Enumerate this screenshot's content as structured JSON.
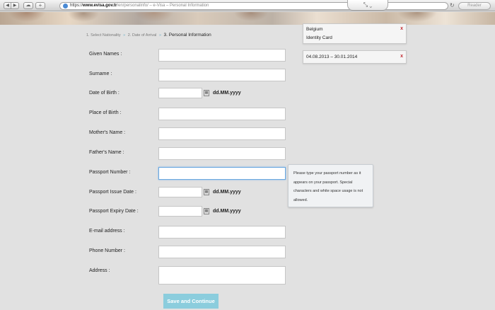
{
  "browser": {
    "url_protocol": "https://",
    "url_host": "www.evisa.gov.tr",
    "url_path": "/en/personalinfo/",
    "page_title": " – e-Visa – Personal Information",
    "reader_label": "Reader",
    "tab_chevron": "⤡  ⌄"
  },
  "steps": {
    "step1": "1. Select Nationality",
    "step2": "2. Date of Arrival",
    "step3": "3. Personal Information",
    "separator": "»"
  },
  "form": {
    "given_names_label": "Given Names :",
    "surname_label": "Surname :",
    "dob_label": "Date of Birth :",
    "place_of_birth_label": "Place of Birth :",
    "mother_label": "Mother's Name :",
    "father_label": "Father's Name :",
    "passport_number_label": "Passport Number :",
    "passport_issue_label": "Passport Issue Date :",
    "passport_expiry_label": "Passport Expiry Date :",
    "email_label": "E-mail address :",
    "phone_label": "Phone Number :",
    "address_label": "Address :",
    "date_format": "dd.MM.yyyy",
    "save_button": "Save and Continue"
  },
  "tooltip": {
    "text": "Please type your passport number as it appears on your passport. Special characters and white space usage is not allowed."
  },
  "summary": {
    "country": "Belgium",
    "document": "Identity Card",
    "date_range": "04.08.2013 – 30.01.2014",
    "remove_symbol": "x"
  },
  "colors": {
    "accent": "#8bcddd",
    "remove": "#c0272d",
    "focus": "#6aa8e0"
  }
}
